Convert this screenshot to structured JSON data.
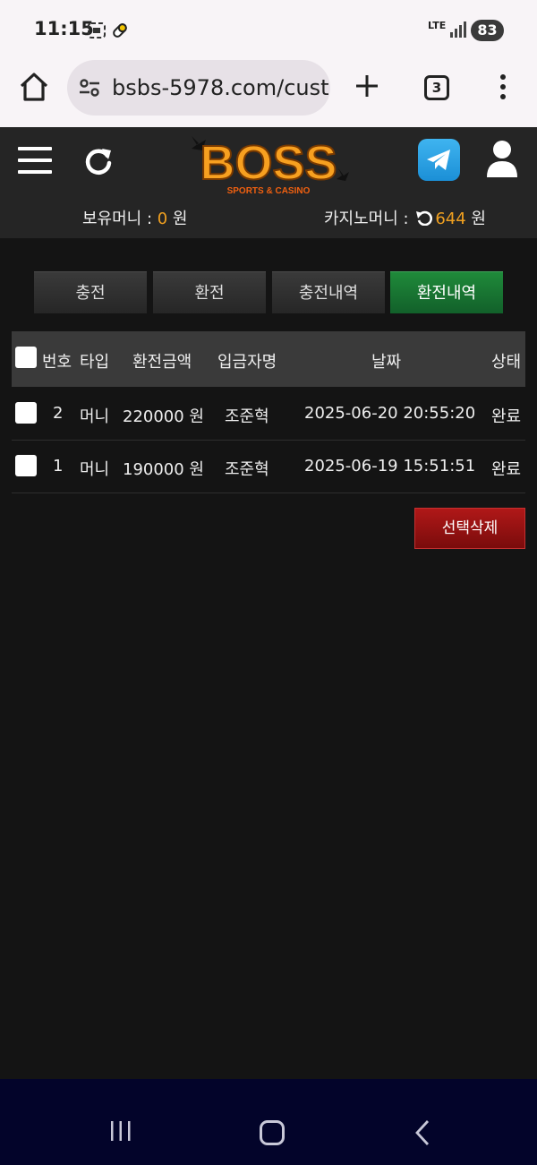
{
  "status_bar": {
    "time": "11:15",
    "network": "LTE",
    "battery": "83"
  },
  "browser": {
    "url": "bsbs-5978.com/cust",
    "tab_count": "3"
  },
  "header": {
    "logo_text": "BOSS",
    "logo_sub": "SPORTS & CASINO",
    "balance_label": "보유머니 : ",
    "balance_value": "0",
    "balance_unit": " 원",
    "casino_label": "카지노머니 : ",
    "casino_value": "644",
    "casino_unit": " 원"
  },
  "tabs": [
    {
      "label": "충전",
      "active": false
    },
    {
      "label": "환전",
      "active": false
    },
    {
      "label": "충전내역",
      "active": false
    },
    {
      "label": "환전내역",
      "active": true
    }
  ],
  "table": {
    "headers": {
      "no": "번호",
      "type": "타입",
      "amount": "환전금액",
      "depositor": "입금자명",
      "date": "날짜",
      "status": "상태"
    },
    "rows": [
      {
        "no": "2",
        "type": "머니",
        "amount": "220000 원",
        "depositor": "조준혁",
        "date": "2025-06-20 20:55:20",
        "status": "완료"
      },
      {
        "no": "1",
        "type": "머니",
        "amount": "190000 원",
        "depositor": "조준혁",
        "date": "2025-06-19 15:51:51",
        "status": "완료"
      }
    ]
  },
  "actions": {
    "delete_selected": "선택삭제"
  },
  "colors": {
    "accent_orange": "#f0a020",
    "active_tab": "#1f8a3a",
    "delete_button": "#9a1010",
    "background": "#141414"
  }
}
